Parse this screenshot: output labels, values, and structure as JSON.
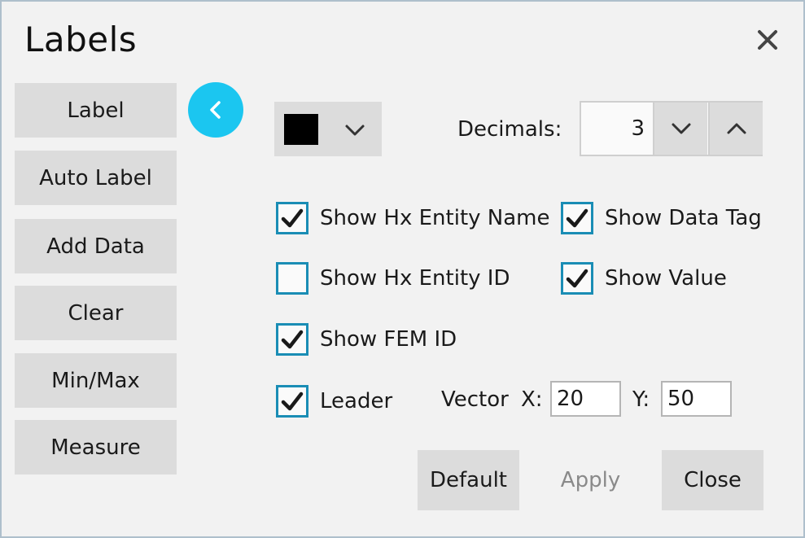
{
  "window": {
    "title": "Labels"
  },
  "sidebar": {
    "items": [
      {
        "label": "Label"
      },
      {
        "label": "Auto Label"
      },
      {
        "label": "Add Data"
      },
      {
        "label": "Clear"
      },
      {
        "label": "Min/Max"
      },
      {
        "label": "Measure"
      }
    ]
  },
  "color_picker": {
    "color": "#000000"
  },
  "decimals": {
    "label": "Decimals:",
    "value": "3"
  },
  "options": {
    "show_hx_entity_name": {
      "label": "Show Hx Entity Name",
      "checked": true
    },
    "show_data_tag": {
      "label": "Show Data Tag",
      "checked": true
    },
    "show_hx_entity_id": {
      "label": "Show Hx Entity ID",
      "checked": false
    },
    "show_value": {
      "label": "Show Value",
      "checked": true
    },
    "show_fem_id": {
      "label": "Show FEM ID",
      "checked": true
    },
    "leader": {
      "label": "Leader",
      "checked": true
    }
  },
  "vector": {
    "label": "Vector",
    "x_label": "X:",
    "x_value": "20",
    "y_label": "Y:",
    "y_value": "50"
  },
  "actions": {
    "default_label": "Default",
    "apply_label": "Apply",
    "close_label": "Close"
  },
  "colors": {
    "accent": "#1bc6f0",
    "checkbox_border": "#1a8db5",
    "button_bg": "#dcdcdc",
    "disabled_text": "#8a8a8a"
  }
}
